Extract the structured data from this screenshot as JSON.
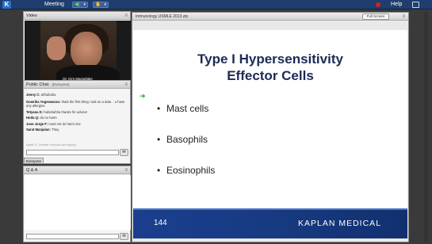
{
  "topbar": {
    "logo_letter": "K",
    "menu_meeting": "Meeting",
    "help": "Help"
  },
  "video_panel": {
    "title": "Video",
    "caption": "Dr. Kim Masselake"
  },
  "chat_panel": {
    "title": "Public Chat",
    "scope": "(Everyone)",
    "messages": [
      {
        "user": "Jenny C:",
        "text": "ahhahaha"
      },
      {
        "user": "Gowrika Yogeswaran:",
        "text": "thats the first thing i ask on a date... u have any allergies"
      },
      {
        "user": "Tetyana D:",
        "text": "hahahahha thanks for advice!"
      },
      {
        "user": "Hoda Q:",
        "text": "do no harm"
      },
      {
        "user": "Jose Jorge F:",
        "text": "must not do harm doc"
      },
      {
        "user": "Sarat Manjalan:",
        "text": "They"
      }
    ],
    "typing": "Nadir S, Debbie Passaro are typing",
    "tab_everyone": "Everyone"
  },
  "qa_panel": {
    "title": "Q & A"
  },
  "slide_panel": {
    "title": "Immunology USMLE 2013.zip",
    "fullscreen_label": "Full Screen"
  },
  "slide": {
    "title_line1": "Type I Hypersensitivity",
    "title_line2": "Effector Cells",
    "bullets": [
      "Mast cells",
      "Basophils",
      "Eosinophils"
    ],
    "page_number": "144",
    "brand": "KAPLAN MEDICAL"
  },
  "colors": {
    "topbar": "#1f3d6e",
    "slide_title": "#1d2a55",
    "footer": "#1a3f8e",
    "record": "#d82020",
    "pointer": "#2ca82c"
  }
}
